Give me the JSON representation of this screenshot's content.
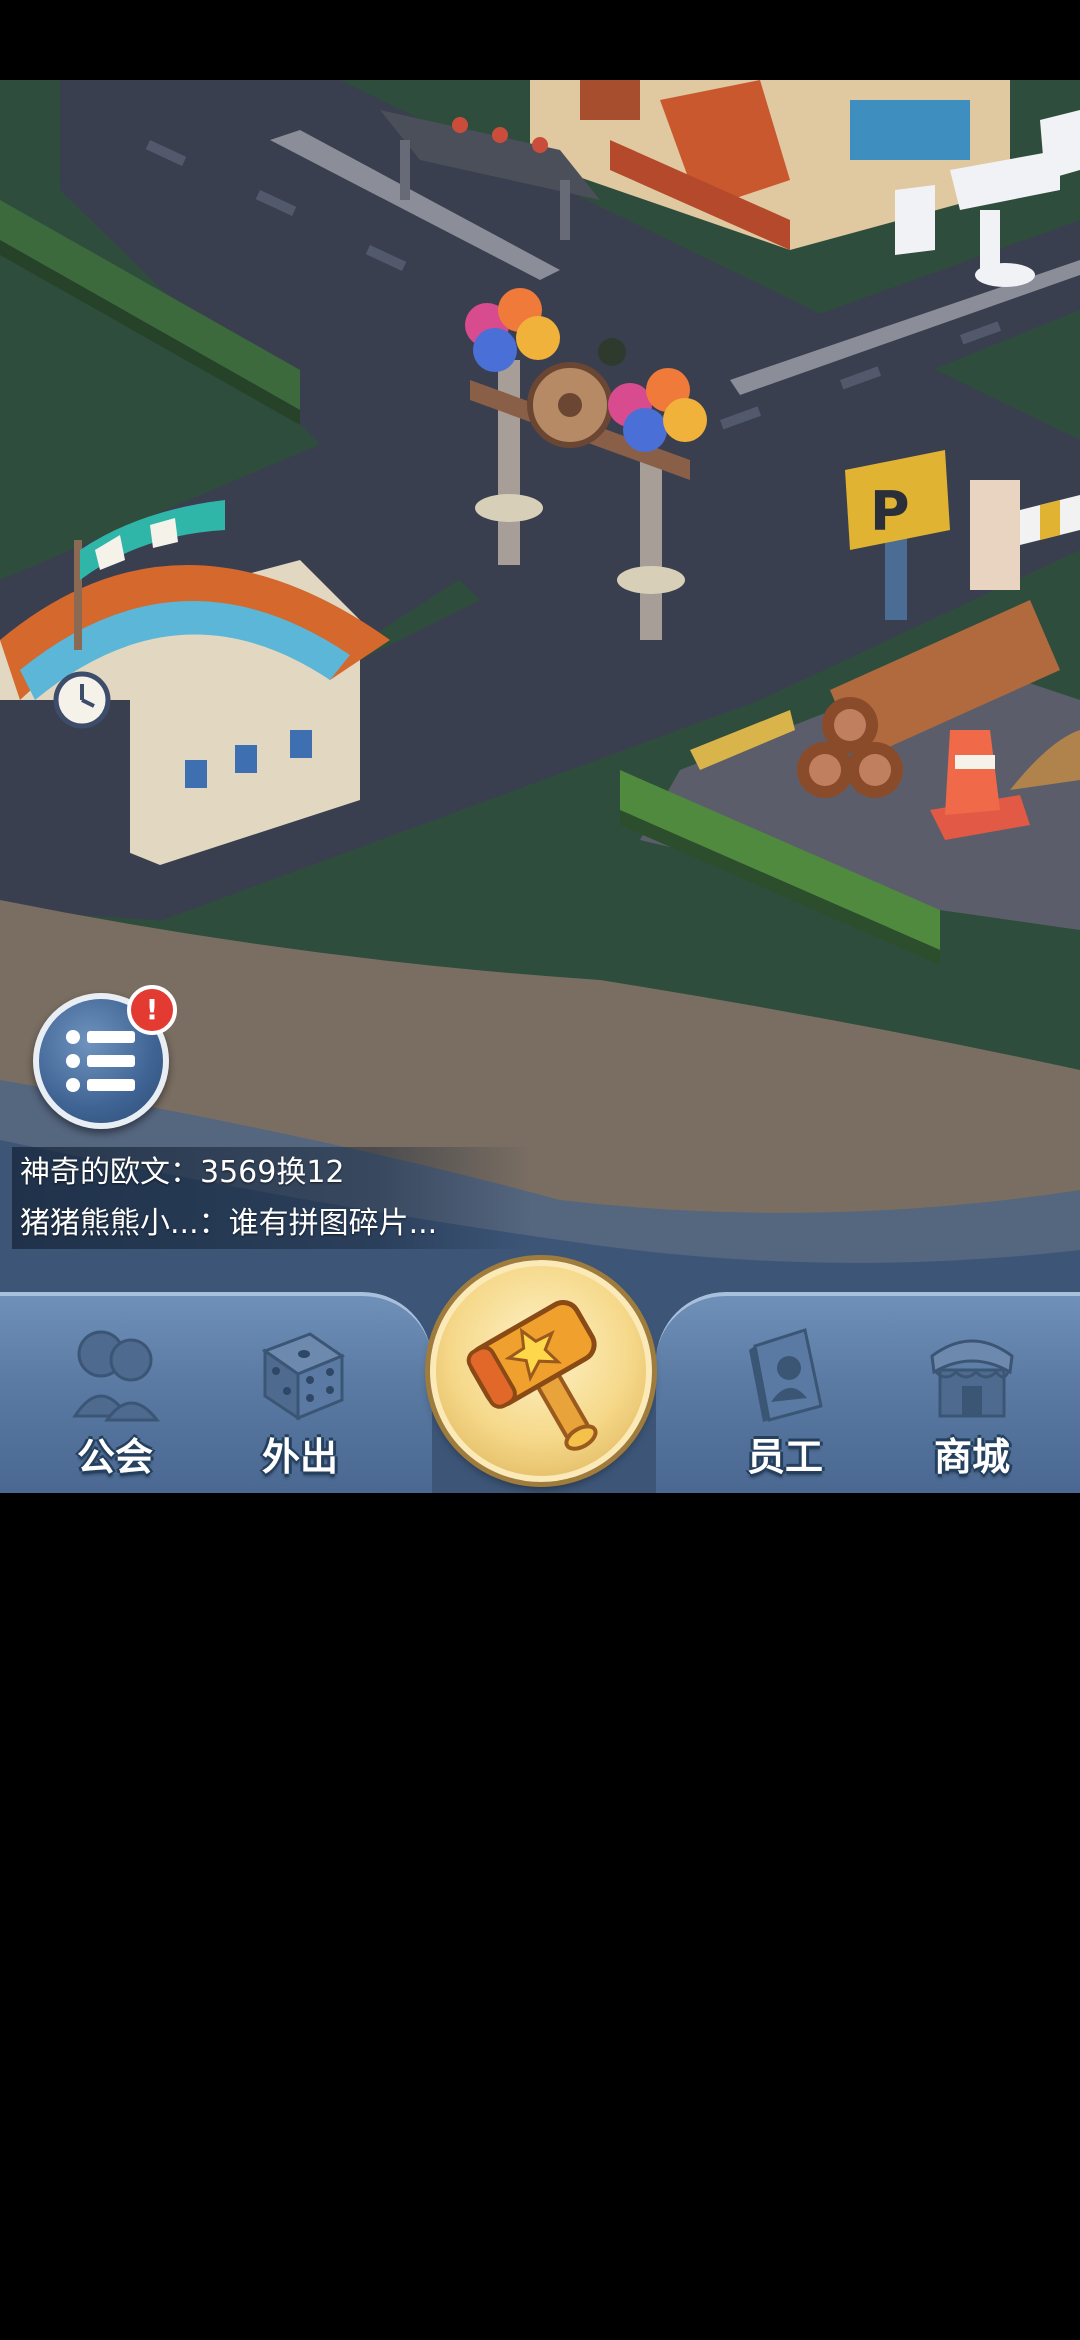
{
  "chat": {
    "messages": [
      {
        "text": "神奇的欧文：3569换12"
      },
      {
        "text": "猪猪熊熊小...：谁有拼图碎片..."
      }
    ]
  },
  "quest_button": {
    "icon": "list-icon",
    "badge_text": "!"
  },
  "navbar": {
    "items": [
      {
        "label": "公会",
        "icon": "guild-characters-icon"
      },
      {
        "label": "外出",
        "icon": "dice-icon"
      },
      {
        "label": "员工",
        "icon": "staff-book-icon"
      },
      {
        "label": "商城",
        "icon": "shop-icon"
      }
    ],
    "center": {
      "icon": "star-hammer-icon"
    }
  },
  "colors": {
    "navbar": "#5a7aa3",
    "center_button": "#f5d889",
    "alert_badge": "#e33a32",
    "grass": "#2f4d3c",
    "road": "#3a3f4f",
    "beach": "#7a6e62"
  }
}
